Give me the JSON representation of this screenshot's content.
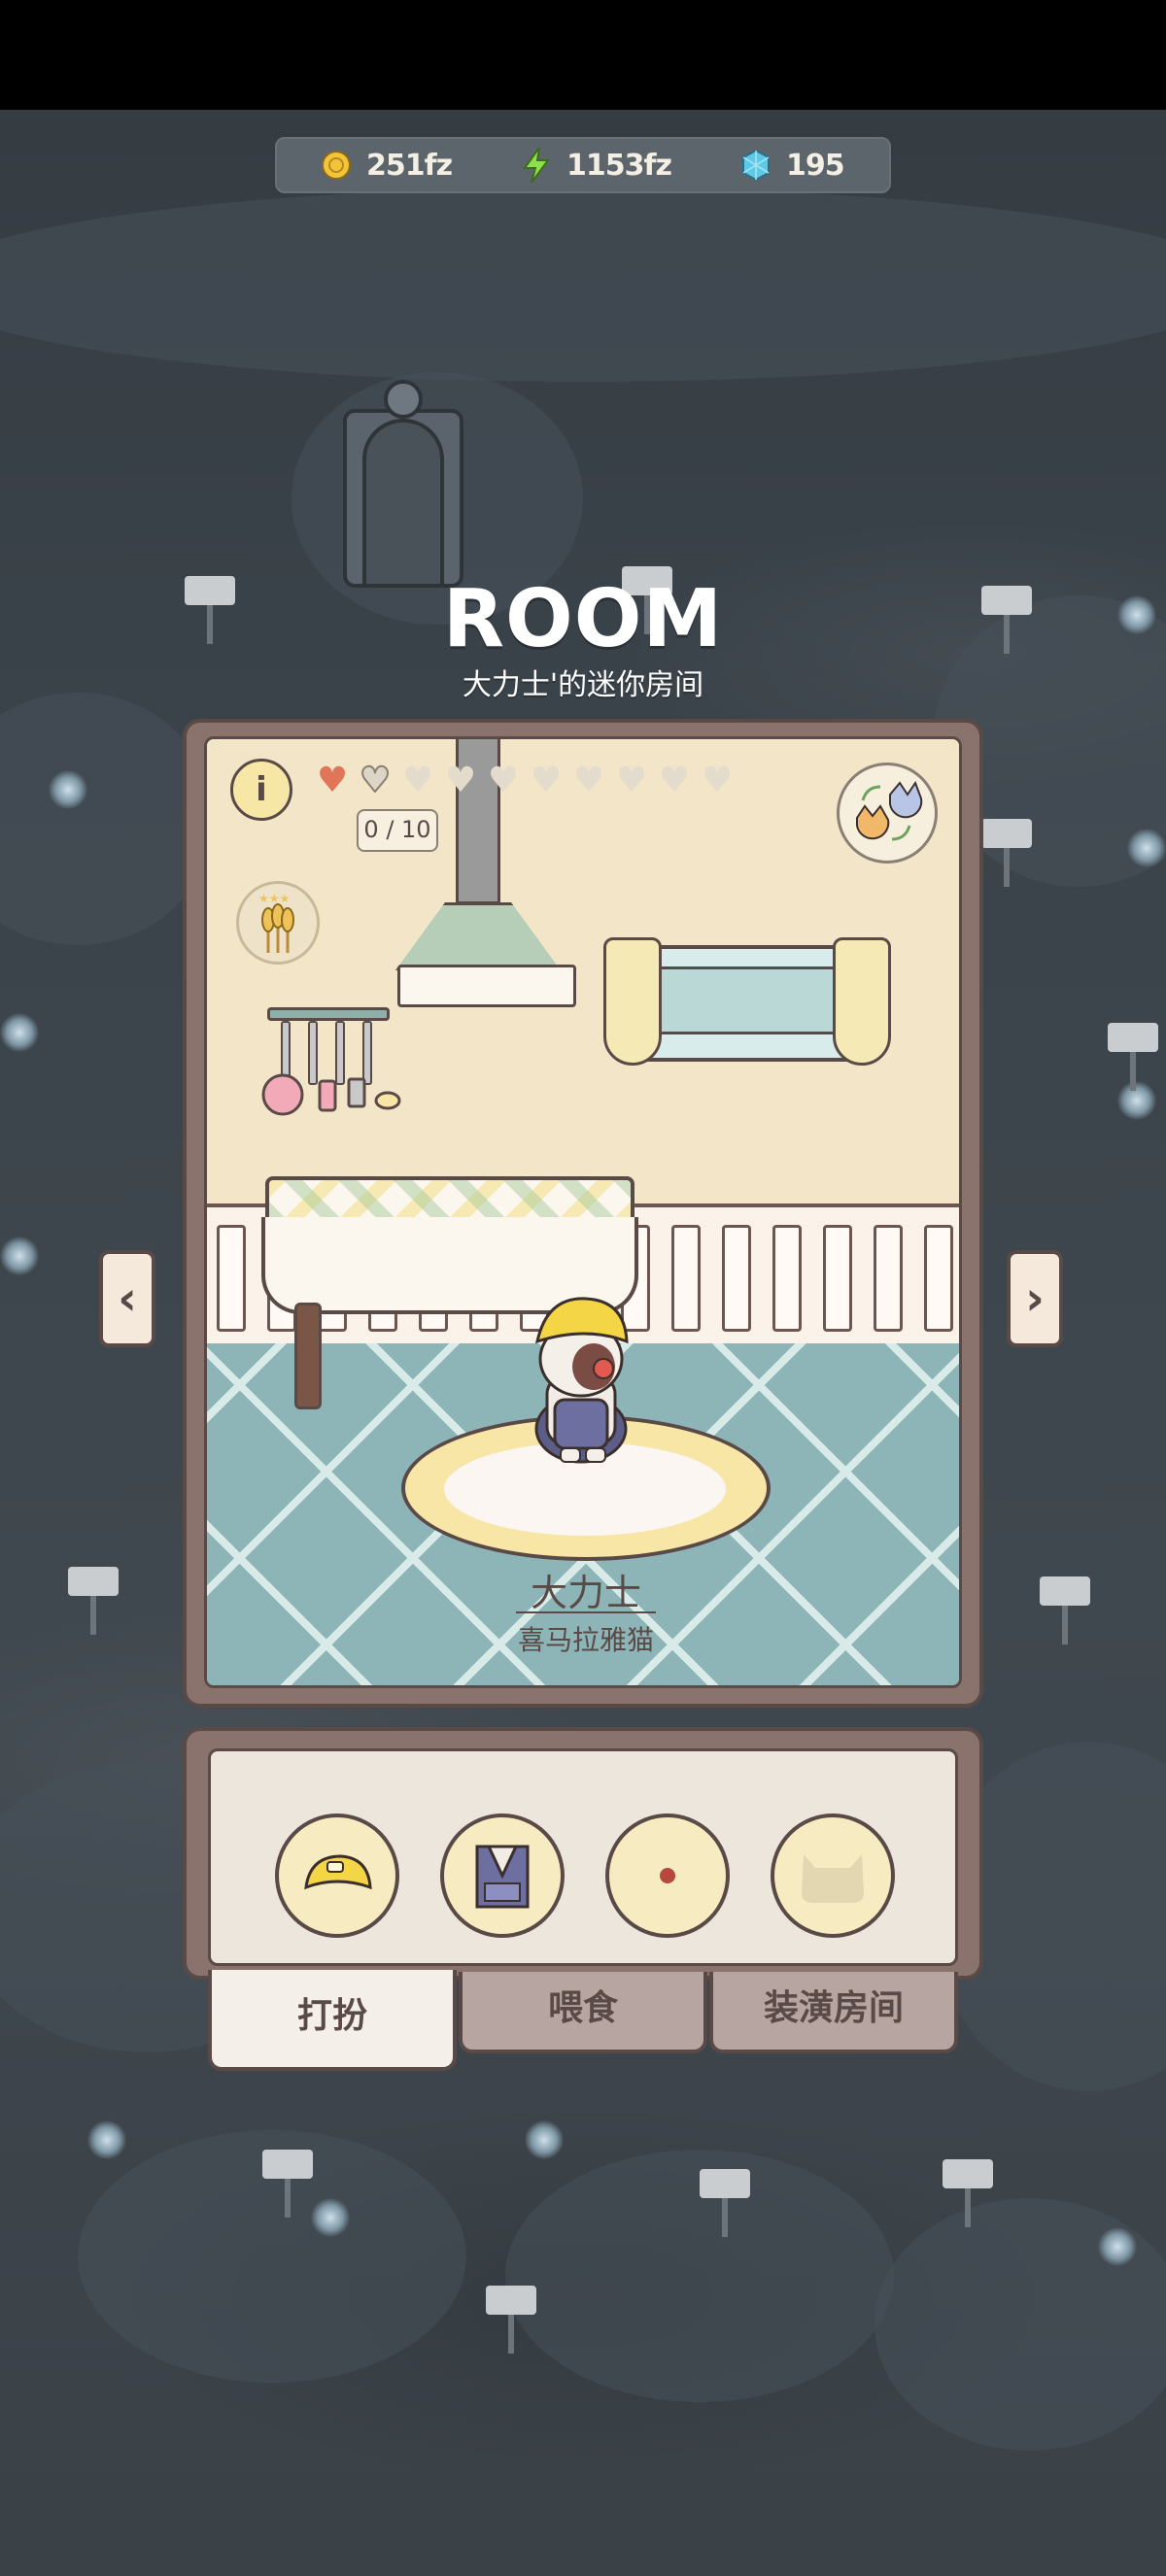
{
  "resources": {
    "coins": "251fz",
    "energy": "1153fz",
    "gems": "195"
  },
  "room": {
    "title": "ROOM",
    "subtitle": "大力士'的迷你房间",
    "love_count": "0 / 10",
    "hearts_filled": 1,
    "hearts_total": 10
  },
  "pet": {
    "name": "大力士",
    "breed": "喜马拉雅猫"
  },
  "panel": {
    "slots": [
      "hat-icon",
      "vest-icon",
      "empty-slot-icon",
      "locked-slot-icon"
    ],
    "tabs": [
      {
        "label": "打扮",
        "active": true
      },
      {
        "label": "喂食",
        "active": false
      },
      {
        "label": "装潢房间",
        "active": false
      }
    ]
  },
  "colors": {
    "frame": "#8a736d",
    "accent_heart": "#e07558",
    "floor": "#8db5b7"
  }
}
